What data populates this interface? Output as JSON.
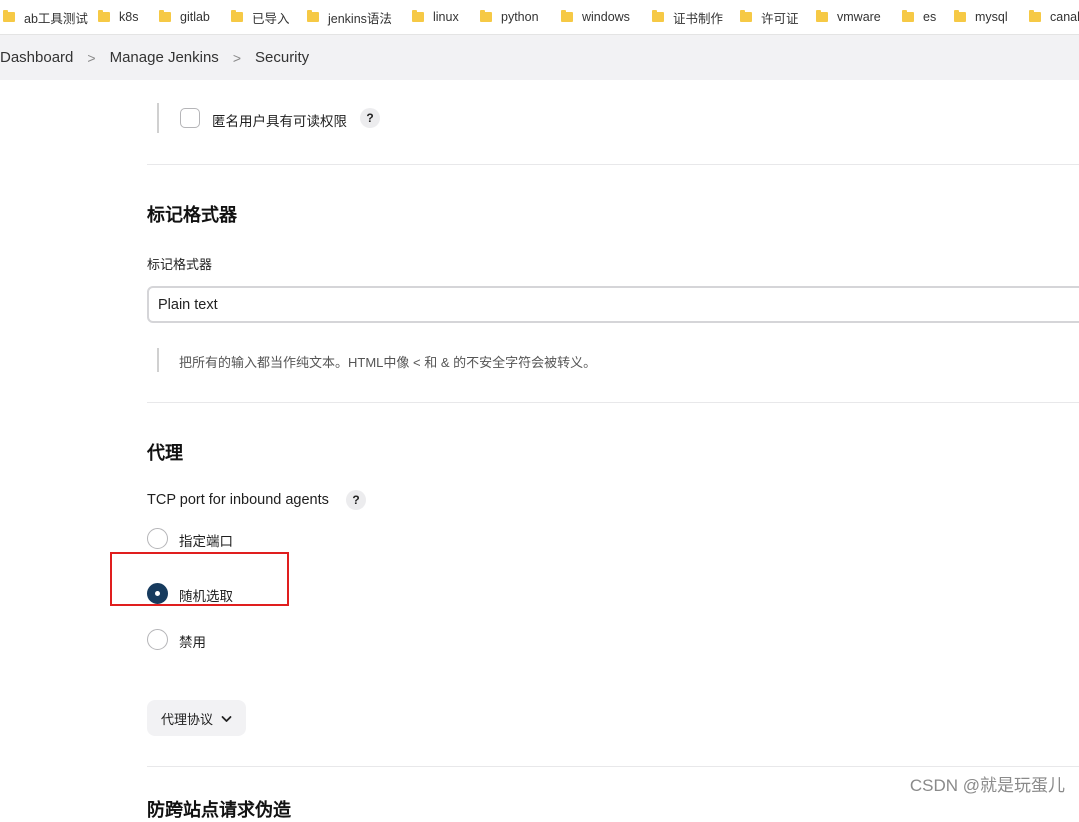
{
  "bookmarks": [
    {
      "label": "ab工具测试",
      "icon": "folder-icon"
    },
    {
      "label": "k8s",
      "icon": "folder-icon"
    },
    {
      "label": "gitlab",
      "icon": "folder-icon"
    },
    {
      "label": "已导入",
      "icon": "folder-icon"
    },
    {
      "label": "jenkins语法",
      "icon": "folder-icon"
    },
    {
      "label": "linux",
      "icon": "folder-icon"
    },
    {
      "label": "python",
      "icon": "folder-icon"
    },
    {
      "label": "windows",
      "icon": "folder-icon"
    },
    {
      "label": "证书制作",
      "icon": "folder-icon"
    },
    {
      "label": "许可证",
      "icon": "folder-icon"
    },
    {
      "label": "vmware",
      "icon": "folder-icon"
    },
    {
      "label": "es",
      "icon": "folder-icon"
    },
    {
      "label": "mysql",
      "icon": "folder-icon"
    },
    {
      "label": "canal",
      "icon": "folder-icon"
    }
  ],
  "breadcrumb": [
    "Dashboard",
    "Manage Jenkins",
    "Security"
  ],
  "breadcrumb_separator": ">",
  "anonymous_read": {
    "label": "匿名用户具有可读权限",
    "checked": false,
    "help": "?"
  },
  "markup_formatter": {
    "section_title": "标记格式器",
    "field_label": "标记格式器",
    "selected": "Plain text",
    "description": "把所有的输入都当作纯文本。HTML中像 < 和 & 的不安全字符会被转义。"
  },
  "agents": {
    "section_title": "代理",
    "tcp_label": "TCP port for inbound agents",
    "help": "?",
    "options": [
      {
        "label": "指定端口",
        "checked": false
      },
      {
        "label": "随机选取",
        "checked": true
      },
      {
        "label": "禁用",
        "checked": false
      }
    ],
    "protocols_button": "代理协议",
    "protocols_icon": "chevron-down-icon"
  },
  "next_section_title": "防跨站点请求伪造",
  "watermark": "CSDN @就是玩蛋儿",
  "colors": {
    "accent": "#173b5e",
    "highlight_box": "#e01e1e",
    "folder": "#f6c945"
  }
}
